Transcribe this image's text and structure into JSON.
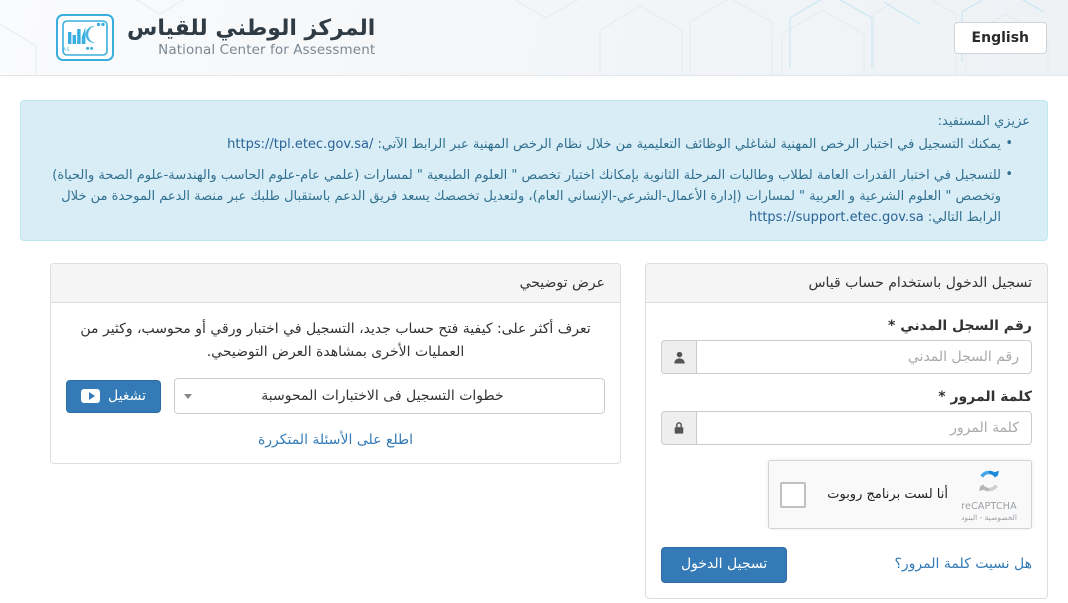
{
  "header": {
    "lang_button": "English",
    "brand_ar": "المركز الوطني للقياس",
    "brand_en": "National Center for Assessment",
    "logo_caption": "QIYAS"
  },
  "alert": {
    "lead": "عزيزي المستفيد:",
    "items": [
      {
        "text_before": "يمكنك التسجيل في اختبار الرخص المهنية لشاغلي الوظائف التعليمية من خلال نظام الرخص المهنية عبر الرابط الآتي:",
        "link": "https://tpl.etec.gov.sa/"
      },
      {
        "text_before": "للتسجيل في اختبار القدرات العامة لطلاب وطالبات المرحلة الثانوية بإمكانك اختيار تخصص \" العلوم الطبيعية \" لمسارات (علمي عام-علوم الحاسب والهندسة-علوم الصحة والحياة) وتخصص \" العلوم الشرعية و العربية \" لمسارات (إدارة الأعمال-الشرعي-الإنساني العام)، ولتعديل تخصصك يسعد فريق الدعم باستقبال طلبك عبر منصة الدعم الموحدة من خلال الرابط التالي:",
        "link": "https://support.etec.gov.sa"
      }
    ]
  },
  "login_panel": {
    "heading": "تسجيل الدخول باستخدام حساب قياس",
    "civil_id": {
      "label": "رقم السجل المدني *",
      "placeholder": "رقم السجل المدني",
      "value": "",
      "icon": "user-icon"
    },
    "password": {
      "label": "كلمة المرور *",
      "placeholder": "كلمة المرور",
      "value": "",
      "icon": "lock-icon"
    },
    "recaptcha": {
      "label": "أنا لست برنامج روبوت",
      "brand": "reCAPTCHA",
      "terms": "الخصوصية - البنود"
    },
    "forgot_password": "هل نسيت كلمة المرور؟",
    "submit": "تسجيل الدخول"
  },
  "demo_panel": {
    "heading": "عرض توضيحي",
    "description": "تعرف أكثر على: كيفية فتح حساب جديد، التسجيل في اختبار ورقي أو محوسب، وكثير من العمليات الأخرى بمشاهدة العرض التوضيحي.",
    "select_value": "خطوات التسجيل فى الاختبارات المحوسبة",
    "play_button": "تشغيل",
    "faq_link": "اطلع على الأسئلة المتكررة"
  },
  "colors": {
    "primary": "#337ab7",
    "alert_bg": "#d9edf7",
    "alert_border": "#bce8f1",
    "alert_text": "#31708f",
    "logo_blue": "#3aaede"
  }
}
